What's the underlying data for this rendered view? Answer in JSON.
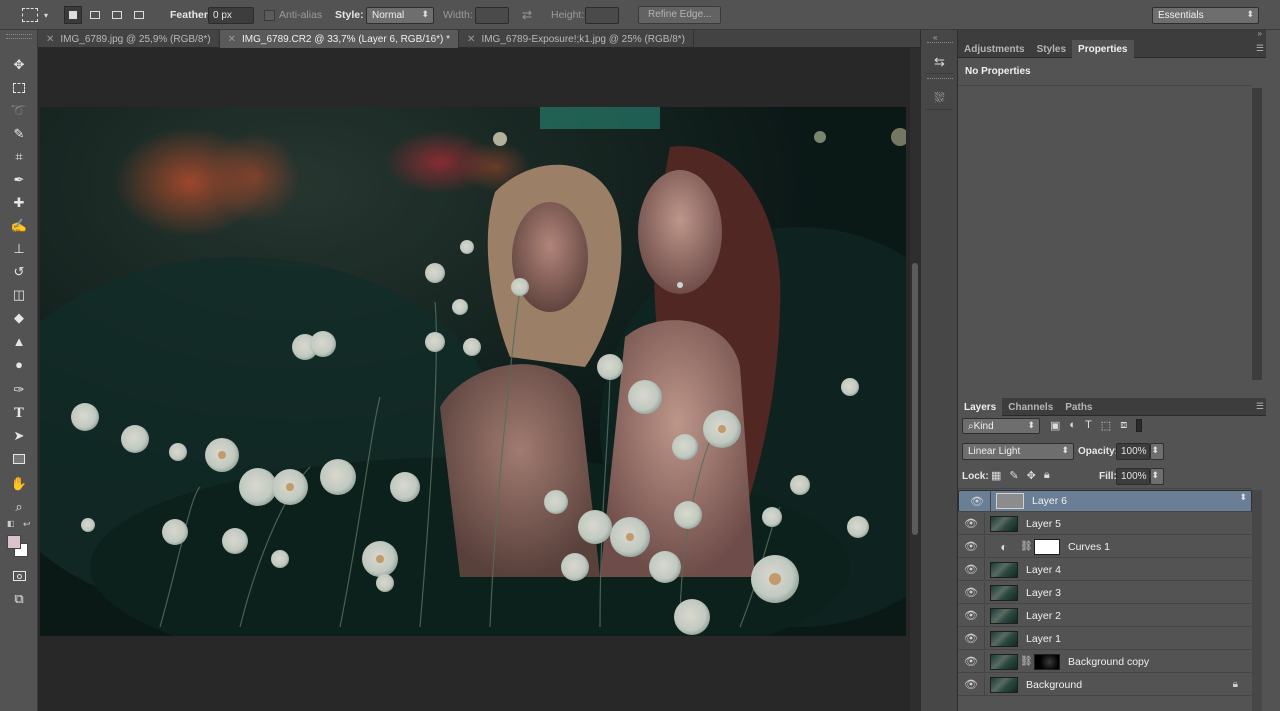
{
  "options": {
    "feather_label": "Feather:",
    "feather_value": "0 px",
    "antialias_label": "Anti-alias",
    "style_label": "Style:",
    "style_value": "Normal",
    "width_label": "Width:",
    "height_label": "Height:",
    "refine_edge_label": "Refine Edge...",
    "workspace_value": "Essentials"
  },
  "tabs": [
    {
      "label": "IMG_6789.jpg @ 25,9% (RGB/8*)"
    },
    {
      "label": "IMG_6789.CR2 @ 33,7% (Layer 6, RGB/16*) *"
    },
    {
      "label": "IMG_6789-Exposure!;k1.jpg @ 25% (RGB/8*)"
    }
  ],
  "active_tab": 1,
  "properties_panel": {
    "tabs": [
      "Adjustments",
      "Styles",
      "Properties"
    ],
    "active": 2,
    "message": "No Properties"
  },
  "layers_panel": {
    "tabs": [
      "Layers",
      "Channels",
      "Paths"
    ],
    "filter_value": "Kind",
    "blend_mode": "Linear Light",
    "opacity_label": "Opacity:",
    "opacity_value": "100%",
    "lock_label": "Lock:",
    "fill_label": "Fill:",
    "fill_value": "100%",
    "layers": [
      {
        "name": "Layer 6",
        "selected": true,
        "thumb": "gray"
      },
      {
        "name": "Layer 5",
        "thumb": "photo"
      },
      {
        "name": "Curves 1",
        "thumb": "adjustment"
      },
      {
        "name": "Layer 4",
        "thumb": "photo"
      },
      {
        "name": "Layer 3",
        "thumb": "photo"
      },
      {
        "name": "Layer 2",
        "thumb": "photo"
      },
      {
        "name": "Layer 1",
        "thumb": "photo"
      },
      {
        "name": "Background copy",
        "thumb": "photo-mask"
      },
      {
        "name": "Background",
        "thumb": "photo",
        "locked": true
      }
    ]
  },
  "tools": [
    "move-tool-icon",
    "marquee-tool-icon",
    "lasso-tool-icon",
    "quick-select-tool-icon",
    "crop-tool-icon",
    "eyedropper-tool-icon",
    "healing-brush-icon",
    "brush-tool-icon",
    "clone-stamp-icon",
    "history-brush-icon",
    "eraser-tool-icon",
    "paint-bucket-icon",
    "blur-tool-icon",
    "dodge-tool-icon",
    "pen-tool-icon",
    "type-tool-icon",
    "path-select-icon",
    "rectangle-tool-icon",
    "hand-tool-icon",
    "zoom-tool-icon"
  ],
  "colors": {
    "foreground": "#d9c3cf",
    "background": "#ffffff",
    "selected_layer": "#6a7f96"
  }
}
